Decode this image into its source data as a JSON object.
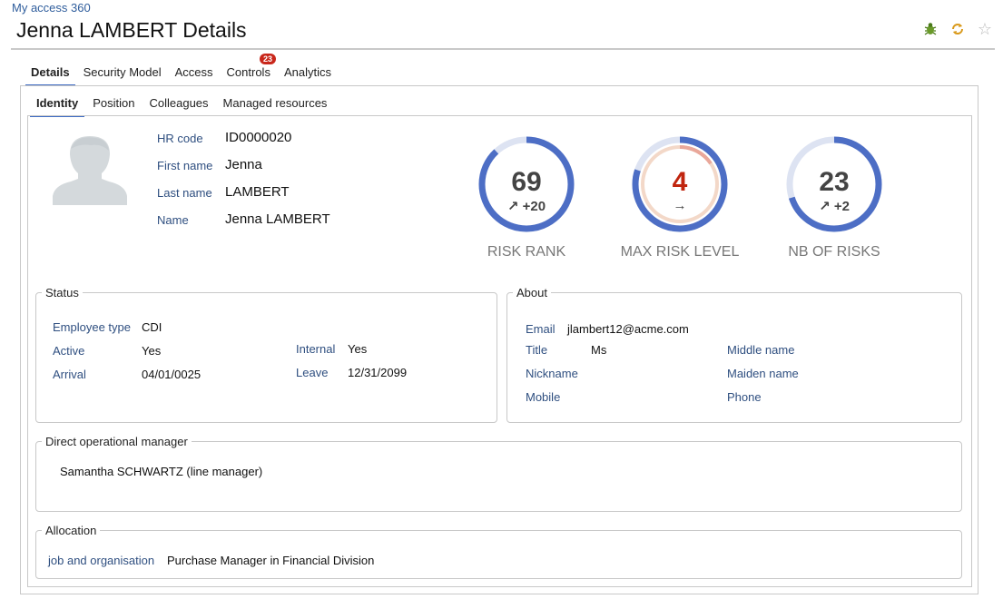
{
  "header": {
    "breadcrumb": "My access 360",
    "title": "Jenna LAMBERT Details"
  },
  "main_tabs": [
    {
      "label": "Details",
      "active": true
    },
    {
      "label": "Security Model"
    },
    {
      "label": "Access"
    },
    {
      "label": "Controls",
      "badge": "23"
    },
    {
      "label": "Analytics"
    }
  ],
  "sub_tabs": [
    {
      "label": "Identity",
      "active": true
    },
    {
      "label": "Position"
    },
    {
      "label": "Colleagues"
    },
    {
      "label": "Managed resources"
    }
  ],
  "identity": {
    "hr_code_label": "HR code",
    "hr_code": "ID0000020",
    "first_name_label": "First name",
    "first_name": "Jenna",
    "last_name_label": "Last name",
    "last_name": "LAMBERT",
    "name_label": "Name",
    "name": "Jenna LAMBERT"
  },
  "gauges": {
    "risk_rank": {
      "value": "69",
      "delta": "+20",
      "caption": "RISK RANK",
      "fill_fraction": 0.88
    },
    "max_risk_level": {
      "value": "4",
      "delta": "",
      "caption": "MAX RISK LEVEL",
      "fill_fraction": 0.8
    },
    "nb_of_risks": {
      "value": "23",
      "delta": "+2",
      "caption": "NB OF RISKS",
      "fill_fraction": 0.7
    }
  },
  "status": {
    "legend": "Status",
    "employee_type_label": "Employee type",
    "employee_type": "CDI",
    "active_label": "Active",
    "active": "Yes",
    "arrival_label": "Arrival",
    "arrival": "04/01/0025",
    "internal_label": "Internal",
    "internal": "Yes",
    "leave_label": "Leave",
    "leave": "12/31/2099"
  },
  "about": {
    "legend": "About",
    "email_label": "Email",
    "email": "jlambert12@acme.com",
    "title_label": "Title",
    "title": "Ms",
    "nickname_label": "Nickname",
    "mobile_label": "Mobile",
    "middle_name_label": "Middle name",
    "maiden_name_label": "Maiden name",
    "phone_label": "Phone"
  },
  "manager": {
    "legend": "Direct operational manager",
    "value": "Samantha SCHWARTZ (line manager)"
  },
  "allocation": {
    "legend": "Allocation",
    "label": "job and organisation",
    "value": "Purchase Manager in Financial Division"
  },
  "colors": {
    "accent": "#3f6cc4",
    "gauge_blue": "#4d6ec5",
    "gauge_track": "#dde3f2",
    "risk_red": "#c0250f",
    "badge_red": "#c9271b"
  },
  "icons": [
    "bug-icon",
    "sync-icon",
    "star-icon"
  ]
}
